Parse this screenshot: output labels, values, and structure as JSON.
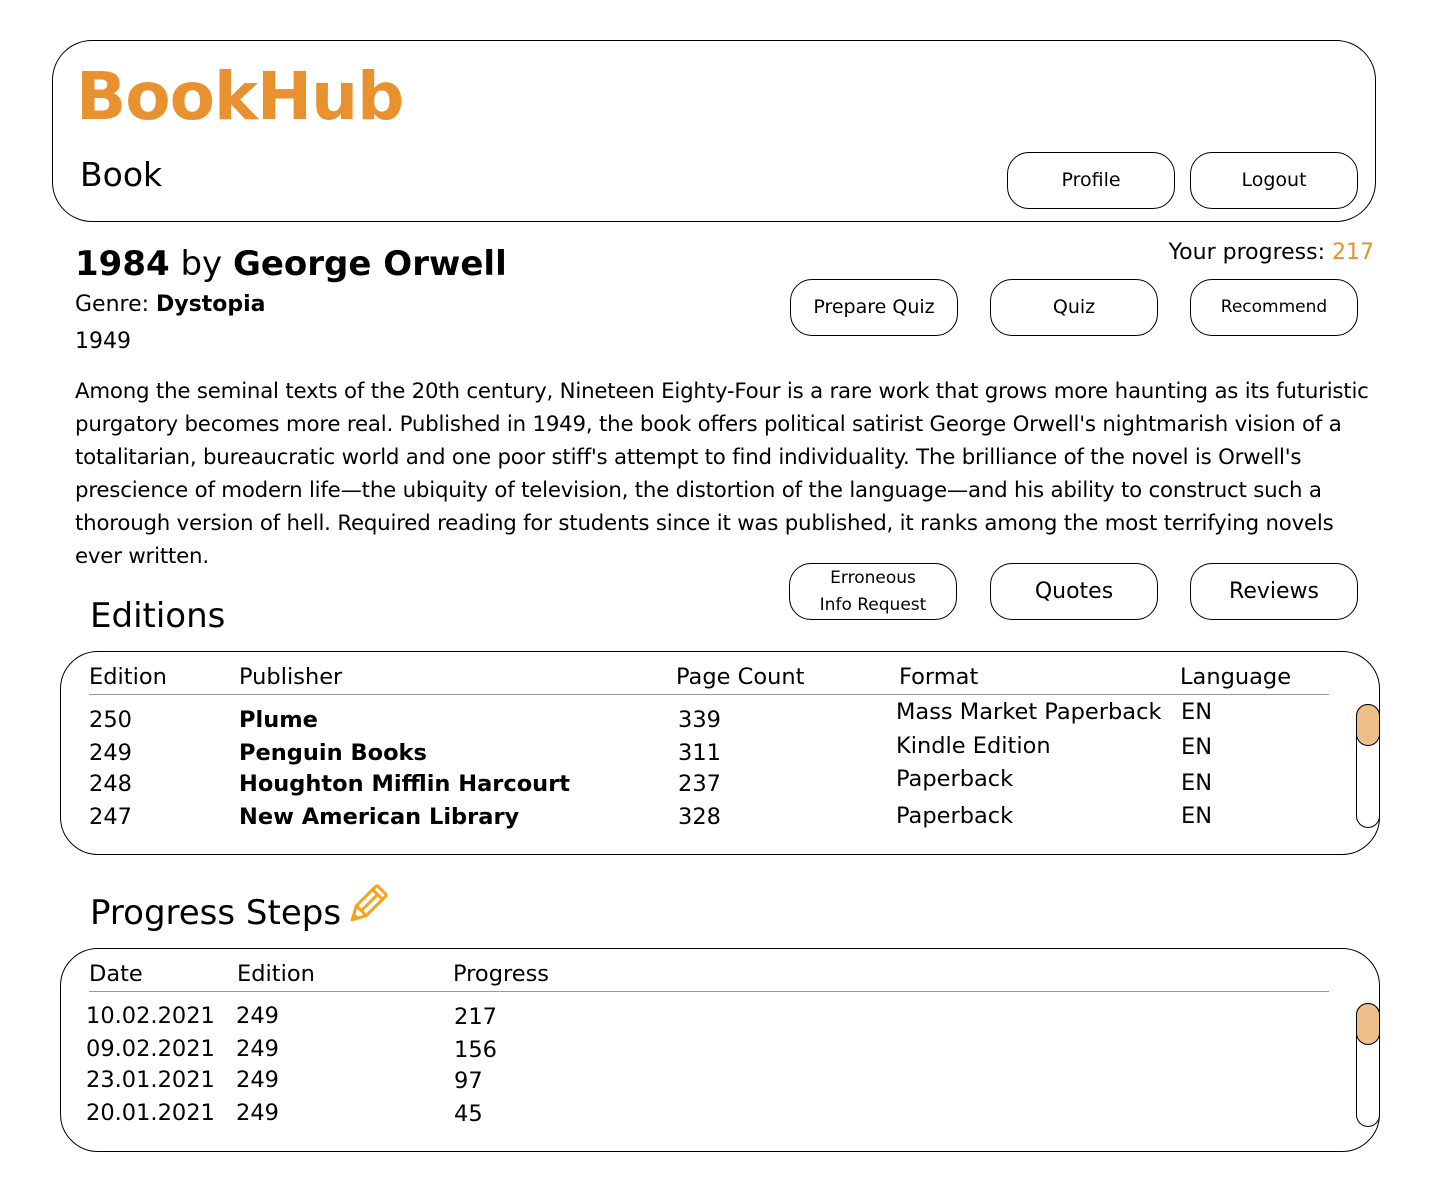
{
  "app": {
    "logo": "BookHub",
    "page_title": "Book",
    "brand_color": "#E8912E",
    "scroll_thumb_color": "#EEBF8B"
  },
  "header": {
    "profile_label": "Profile",
    "logout_label": "Logout"
  },
  "book": {
    "title": "1984",
    "by": "by",
    "author": "George Orwell",
    "genre_label": "Genre:",
    "genre": "Dystopia",
    "year": "1949",
    "description": "Among the seminal texts of the 20th century, Nineteen Eighty-Four is a rare work that grows more haunting as its futuristic purgatory becomes more real. Published in 1949, the book offers political satirist George Orwell's nightmarish vision of a totalitarian, bureaucratic world and one poor stiff's attempt to find individuality. The brilliance of the novel is Orwell's prescience of modern life—the ubiquity of television, the distortion of the language—and his ability to construct such a thorough version of hell. Required reading for students since it was published, it ranks among the most terrifying novels ever written."
  },
  "progress": {
    "label": "Your progress:",
    "value": "217"
  },
  "actions": {
    "prepare_quiz": "Prepare Quiz",
    "quiz": "Quiz",
    "recommend": "Recommend",
    "erroneous_line1": "Erroneous",
    "erroneous_line2": "Info Request",
    "quotes": "Quotes",
    "reviews": "Reviews"
  },
  "editions": {
    "title": "Editions",
    "headers": [
      "Edition",
      "Publisher",
      "Page Count",
      "Format",
      "Language"
    ],
    "rows": [
      [
        "250",
        "Plume",
        "339",
        "Mass Market Paperback",
        "EN"
      ],
      [
        "249",
        "Penguin Books",
        "311",
        "Kindle Edition",
        "EN"
      ],
      [
        "248",
        "Houghton Mifflin Harcourt",
        "237",
        "Paperback",
        "EN"
      ],
      [
        "247",
        "New American Library",
        "328",
        "Paperback",
        "EN"
      ]
    ]
  },
  "progress_steps": {
    "title": "Progress Steps",
    "edit_icon": "pencil-icon",
    "headers": [
      "Date",
      "Edition",
      "Progress"
    ],
    "rows": [
      [
        "10.02.2021",
        "249",
        "217"
      ],
      [
        "09.02.2021",
        "249",
        "156"
      ],
      [
        "23.01.2021",
        "249",
        "97"
      ],
      [
        "20.01.2021",
        "249",
        "45"
      ]
    ]
  }
}
